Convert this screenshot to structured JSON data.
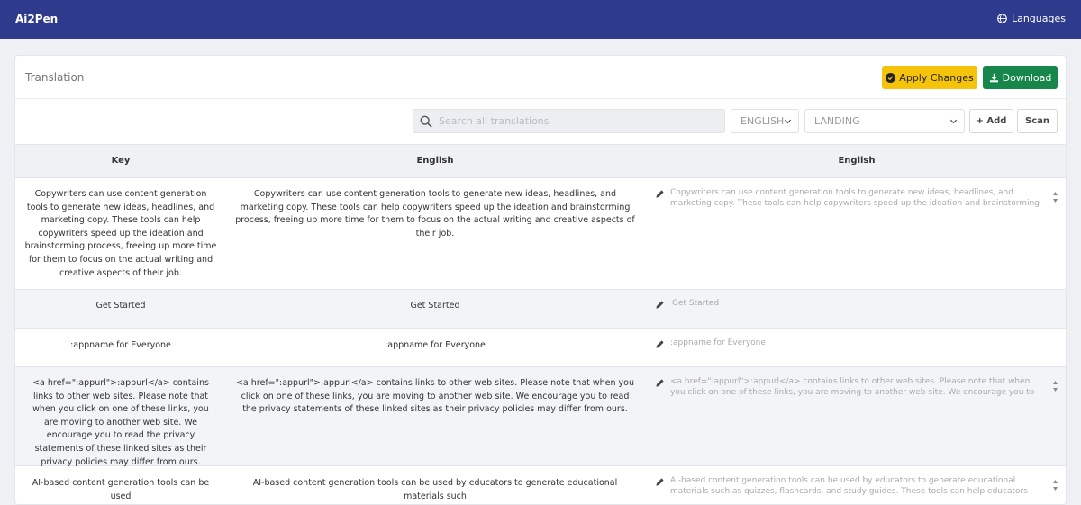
{
  "navbar": {
    "brand": "Ai2Pen",
    "languages_label": "Languages",
    "bg_color": "#2e3a8c"
  },
  "page": {
    "title": "Translation",
    "apply_label": "Apply Changes",
    "download_label": "Download",
    "apply_color": "#f5c40a",
    "download_color": "#17864a"
  },
  "toolbar": {
    "search_placeholder": "Search all translations",
    "language_select": "ENGLISH",
    "group_select": "LANDING",
    "add_label": "+ Add",
    "scan_label": "Scan"
  },
  "table": {
    "headers": [
      "Key",
      "English",
      "English"
    ],
    "rows": [
      {
        "key": "Copywriters can use content generation tools to generate new ideas, headlines, and marketing copy. These tools can help copywriters speed up the ideation and brainstorming process, freeing up more time for them to focus on the actual writing and creative aspects of their job.",
        "english": "Copywriters can use content generation tools to generate new ideas, headlines, and marketing copy. These tools can help copywriters speed up the ideation and brainstorming process, freeing up more time for them to focus on the actual writing and creative aspects of their job.",
        "translation": "Copywriters can use content generation tools to generate new ideas, headlines, and marketing copy. These tools can help copywriters speed up the ideation and brainstorming process, freeing up more time for them to focus on the actual writing and creative aspects of their job."
      },
      {
        "key": "Get Started",
        "english": "Get Started",
        "translation": "Get Started"
      },
      {
        "key": ":appname for Everyone",
        "english": ":appname for Everyone",
        "translation": ":appname for Everyone"
      },
      {
        "key": "<a href=\":appurl\">:appurl</a> contains links to other web sites. Please note that when you click on one of these links, you are moving to another web site. We encourage you to read the privacy statements of these linked sites as their privacy policies may differ from ours.",
        "english": "<a href=\":appurl\">:appurl</a> contains links to other web sites. Please note that when you click on one of these links, you are moving to another web site. We encourage you to read the privacy statements of these linked sites as their privacy policies may differ from ours.",
        "translation": "<a href=\":appurl\">:appurl</a> contains links to other web sites. Please note that when you click on one of these links, you are moving to another web site. We encourage you to read the privacy statements of these linked sites as their privacy policies may differ from ours."
      },
      {
        "key": "AI-based content generation tools can be used",
        "english": "AI-based content generation tools can be used by educators to generate educational materials such",
        "translation": "AI-based content generation tools can be used by educators to generate educational materials such as quizzes, flashcards, and study guides. These tools can help educators create personalized learning"
      }
    ]
  }
}
